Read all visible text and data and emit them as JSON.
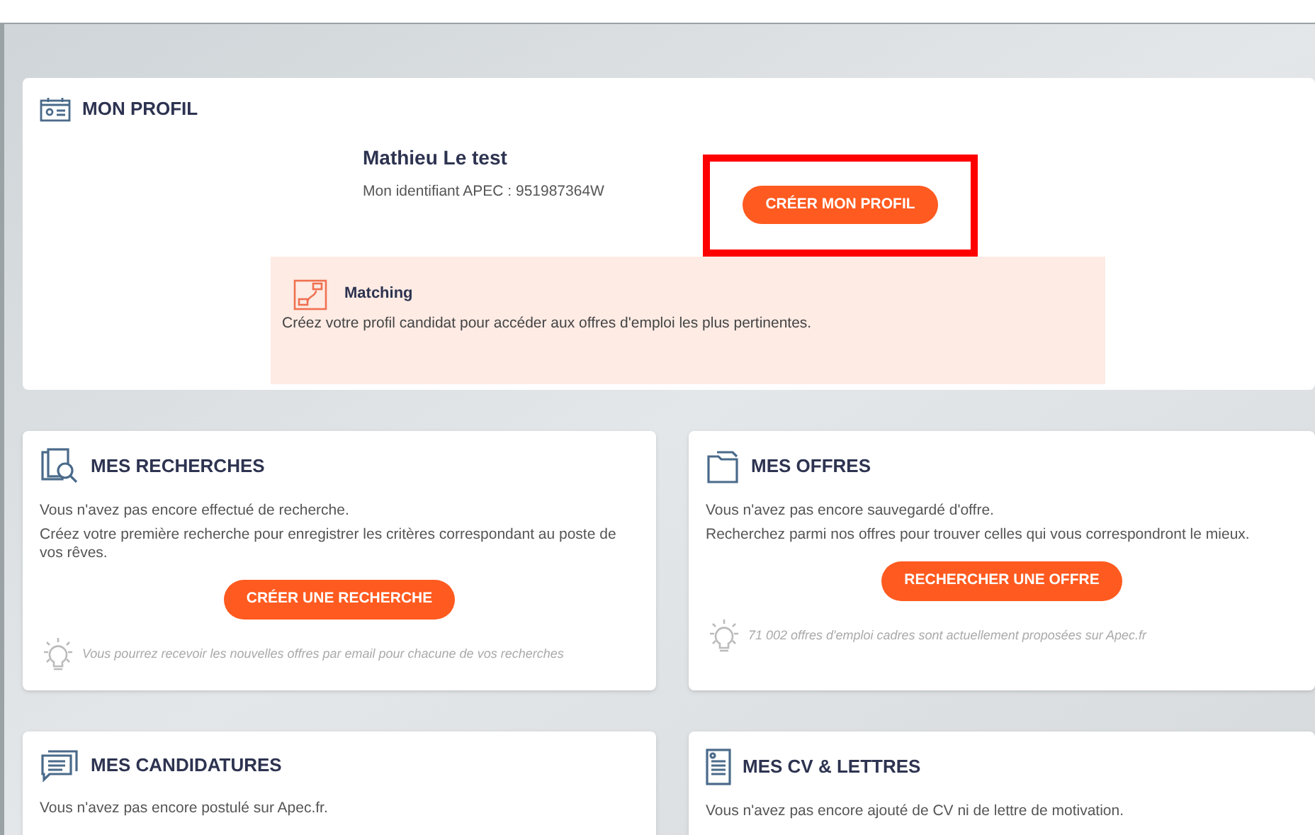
{
  "profile": {
    "title": "MON PROFIL",
    "name": "Mathieu Le test",
    "identifier": "Mon identifiant APEC : 951987364W",
    "button": {
      "label": "CRÉER MON PROFIL",
      "highlighted": true
    },
    "matching": {
      "title": "Matching",
      "text": "Créez votre profil candidat pour accéder aux offres d'emploi les plus pertinentes."
    }
  },
  "cards": [
    {
      "kind": "search",
      "title": "MES RECHERCHES",
      "lines": [
        "Vous n'avez pas encore effectué de recherche.",
        "Créez votre première recherche pour enregistrer les critères correspondant au poste de vos rêves."
      ],
      "button": "CRÉER UNE RECHERCHE",
      "tip": "Vous pourrez recevoir les nouvelles offres par email pour chacune de vos recherches"
    },
    {
      "kind": "folder",
      "title": "MES OFFRES",
      "lines": [
        "Vous n'avez pas encore sauvegardé d'offre.",
        "Recherchez parmi nos offres pour trouver celles qui vous correspondront le mieux."
      ],
      "button": "RECHERCHER UNE OFFRE",
      "tip": "71 002 offres d'emploi cadres sont actuellement proposées sur Apec.fr"
    },
    {
      "kind": "chat",
      "title": "MES CANDIDATURES",
      "lines": [
        "Vous n'avez pas encore postulé sur Apec.fr."
      ]
    },
    {
      "kind": "document",
      "title": "MES CV & LETTRES",
      "lines": [
        "Vous n'avez pas encore ajouté de CV ni de lettre de motivation."
      ]
    }
  ]
}
